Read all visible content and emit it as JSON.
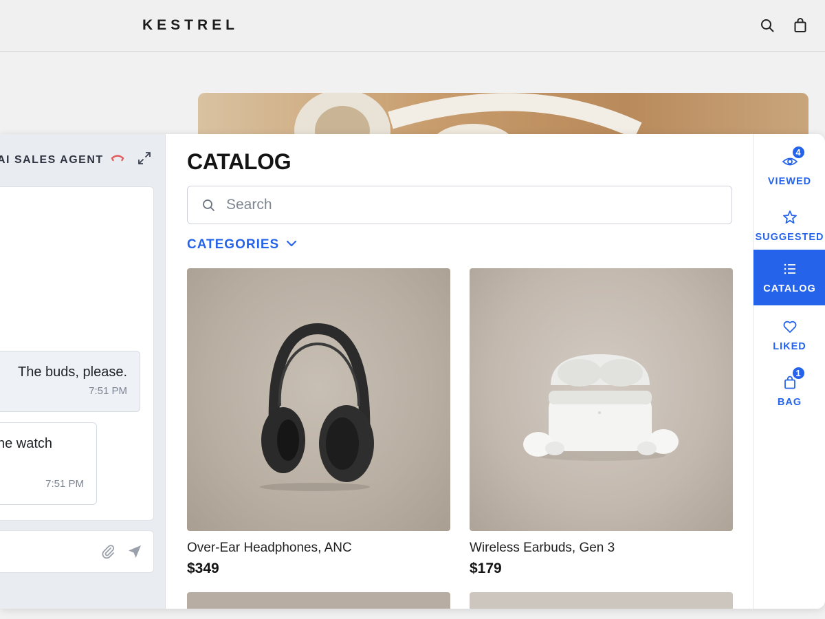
{
  "header": {
    "brand": "KESTREL",
    "icons": [
      "search-icon",
      "bag-icon"
    ]
  },
  "chat": {
    "title": "AI SALES AGENT",
    "messages": [
      {
        "role": "user",
        "text": "The buds, please.",
        "time": "7:51 PM"
      },
      {
        "role": "agent",
        "text": "he watch",
        "time": "7:51 PM"
      }
    ]
  },
  "catalog": {
    "title": "CATALOG",
    "search": {
      "placeholder": "Search",
      "value": ""
    },
    "categories_label": "CATEGORIES",
    "products": [
      {
        "name": "Over-Ear Headphones, ANC",
        "price": "$349"
      },
      {
        "name": "Wireless Earbuds, Gen 3",
        "price": "$179"
      }
    ]
  },
  "rail": {
    "items": [
      {
        "label": "VIEWED",
        "icon": "eye-icon",
        "badge": "4",
        "active": false
      },
      {
        "label": "SUGGESTED",
        "icon": "star-icon",
        "badge": null,
        "active": false
      },
      {
        "label": "CATALOG",
        "icon": "list-icon",
        "badge": null,
        "active": true
      },
      {
        "label": "LIKED",
        "icon": "heart-icon",
        "badge": null,
        "active": false
      },
      {
        "label": "BAG",
        "icon": "bag-icon",
        "badge": "1",
        "active": false
      }
    ]
  },
  "colors": {
    "accent": "#2563eb",
    "hangup": "#e25c5c"
  }
}
